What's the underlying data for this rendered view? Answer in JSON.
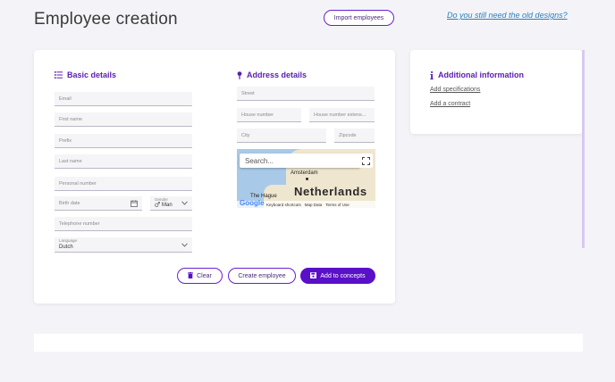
{
  "header": {
    "title": "Employee creation",
    "import_label": "Import employees",
    "old_designs_link": "Do you still need the old designs?"
  },
  "basic": {
    "title": "Basic details",
    "email_ph": "Email",
    "first_name_ph": "First name",
    "prefix_ph": "Prefix",
    "last_name_ph": "Last name",
    "personal_number_ph": "Personal number",
    "birth_date_ph": "Birth date",
    "gender_label": "Gender",
    "gender_value": "Man",
    "telephone_ph": "Telephone number",
    "language_label": "Language",
    "language_value": "Dutch"
  },
  "address": {
    "title": "Address details",
    "street_ph": "Street",
    "house_number_ph": "House number",
    "house_ext_ph": "House number extens...",
    "city_ph": "City",
    "zipcode_ph": "Zipcode",
    "map": {
      "search_ph": "Search...",
      "city_label": "Amsterdam",
      "country_label": "Netherlands",
      "hague_label": "The Hague",
      "google_label": "Google",
      "keyboard_label": "Keyboard shortcuts",
      "mapdata_label": "Map Data",
      "terms_label": "Terms of Use"
    }
  },
  "actions": {
    "clear_label": "Clear",
    "create_label": "Create employee",
    "concepts_label": "Add to concepts"
  },
  "additional": {
    "title": "Additional information",
    "add_specifications": "Add specifications",
    "add_contract": "Add a contract"
  },
  "colors": {
    "accent": "#5a0fc8",
    "link": "#2a7fc0",
    "background": "#f4f4f8"
  },
  "icons": [
    "list-icon",
    "pin-icon",
    "info-icon",
    "calendar-icon",
    "male-icon",
    "chevron-down-icon",
    "trash-icon",
    "save-icon",
    "fullscreen-icon"
  ]
}
